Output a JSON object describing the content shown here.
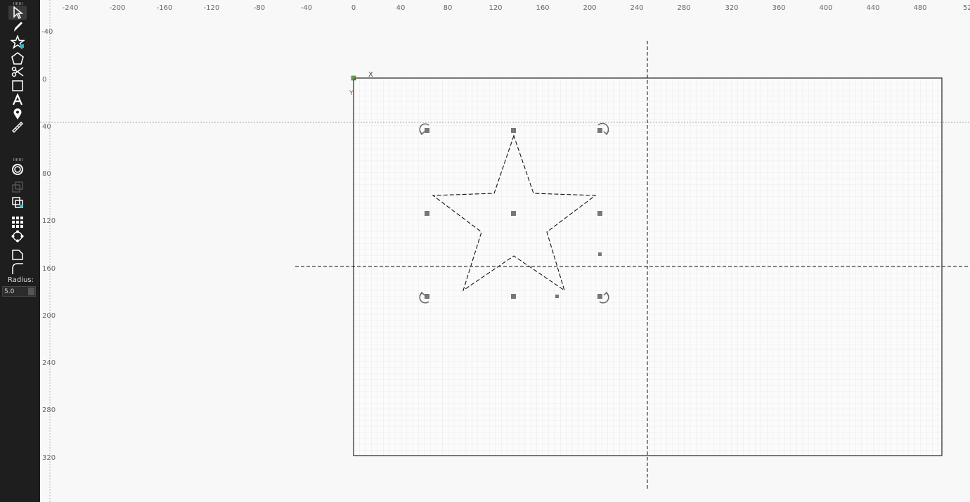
{
  "toolbar": {
    "tools": [
      {
        "id": "select",
        "icon": "select-arrow-icon"
      },
      {
        "id": "pen",
        "icon": "pen-icon"
      },
      {
        "id": "star",
        "icon": "star-icon"
      },
      {
        "id": "polygon",
        "icon": "polygon-icon"
      },
      {
        "id": "scissors",
        "icon": "scissors-icon"
      },
      {
        "id": "rectangle",
        "icon": "rectangle-icon"
      },
      {
        "id": "text",
        "icon": "text-icon"
      },
      {
        "id": "pin",
        "icon": "map-pin-icon"
      },
      {
        "id": "measure",
        "icon": "ruler-icon"
      },
      {
        "id": "offset",
        "icon": "offset-ring-icon"
      },
      {
        "id": "boolean-union",
        "icon": "union-squares-icon"
      },
      {
        "id": "boolean-intersect",
        "icon": "intersect-squares-icon"
      },
      {
        "id": "array-grid",
        "icon": "grid-array-icon"
      },
      {
        "id": "array-circular",
        "icon": "circular-array-icon"
      },
      {
        "id": "corner-edit",
        "icon": "corner-edit-icon"
      },
      {
        "id": "fillet",
        "icon": "fillet-icon"
      }
    ],
    "radius_label": "Radius:",
    "radius_value": "5.0"
  },
  "rulers": {
    "top_labels": [
      "-240",
      "-200",
      "-160",
      "-120",
      "-80",
      "-40",
      "0",
      "40",
      "80",
      "120",
      "160",
      "200",
      "240",
      "280",
      "320",
      "360",
      "400",
      "440",
      "480",
      "52"
    ],
    "left_labels": [
      "-40",
      "0",
      "40",
      "80",
      "120",
      "160",
      "200",
      "240",
      "280",
      "320"
    ]
  },
  "origin_axis": {
    "x_label": "X",
    "y_label": "Y"
  },
  "colors": {
    "toolbar": "#1e1e1e",
    "canvas": "#f8f8f8",
    "grid": "#e0e0e0",
    "origin": "#4caf50"
  }
}
